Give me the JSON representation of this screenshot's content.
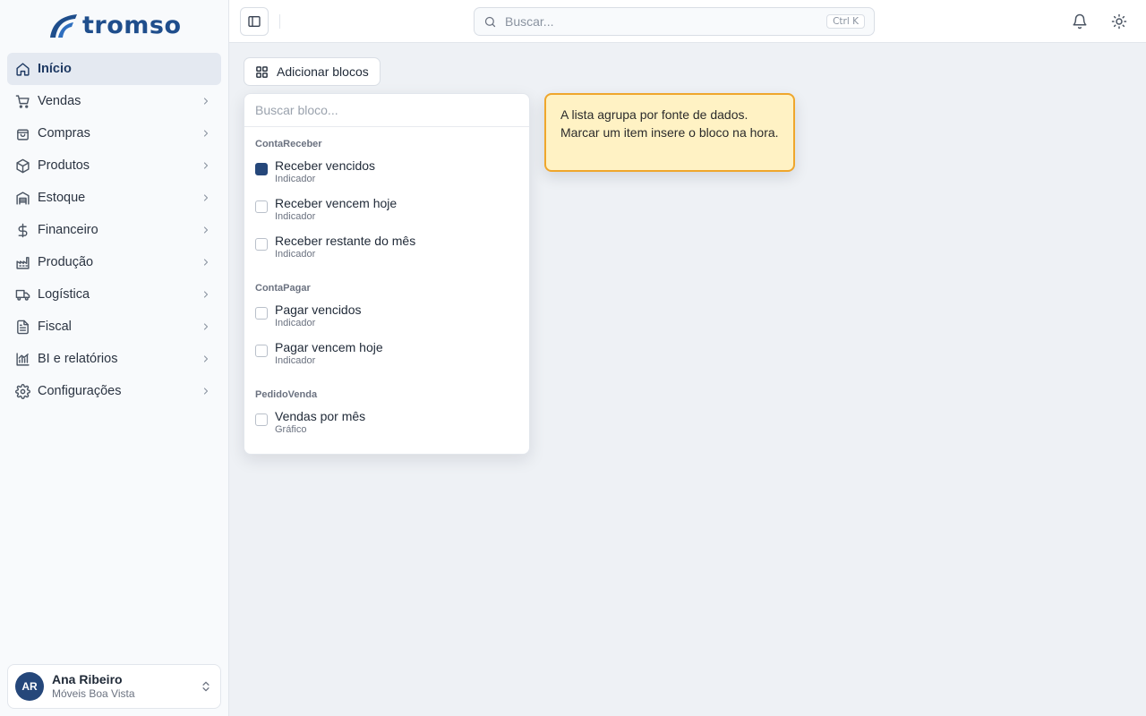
{
  "app": {
    "logo_text": "tromso"
  },
  "sidebar": {
    "items": [
      {
        "label": "Início",
        "icon": "home-icon",
        "active": true
      },
      {
        "label": "Vendas",
        "icon": "cart-icon"
      },
      {
        "label": "Compras",
        "icon": "shopping-bag-icon"
      },
      {
        "label": "Produtos",
        "icon": "package-icon"
      },
      {
        "label": "Estoque",
        "icon": "warehouse-icon"
      },
      {
        "label": "Financeiro",
        "icon": "dollar-icon"
      },
      {
        "label": "Produção",
        "icon": "factory-icon"
      },
      {
        "label": "Logística",
        "icon": "truck-icon"
      },
      {
        "label": "Fiscal",
        "icon": "file-text-icon"
      },
      {
        "label": "BI e relatórios",
        "icon": "chart-icon"
      },
      {
        "label": "Configurações",
        "icon": "gear-icon"
      }
    ],
    "user": {
      "initials": "AR",
      "name": "Ana Ribeiro",
      "company": "Móveis Boa Vista"
    }
  },
  "header": {
    "search_placeholder": "Buscar...",
    "search_shortcut": "Ctrl K"
  },
  "main": {
    "add_blocks_label": "Adicionar blocos",
    "block_picker": {
      "search_placeholder": "Buscar bloco...",
      "groups": [
        {
          "title": "ContaReceber",
          "items": [
            {
              "label": "Receber vencidos",
              "type": "Indicador",
              "checked": true
            },
            {
              "label": "Receber vencem hoje",
              "type": "Indicador",
              "checked": false
            },
            {
              "label": "Receber restante do mês",
              "type": "Indicador",
              "checked": false
            }
          ]
        },
        {
          "title": "ContaPagar",
          "items": [
            {
              "label": "Pagar vencidos",
              "type": "Indicador",
              "checked": false
            },
            {
              "label": "Pagar vencem hoje",
              "type": "Indicador",
              "checked": false
            }
          ]
        },
        {
          "title": "PedidoVenda",
          "items": [
            {
              "label": "Vendas por mês",
              "type": "Gráfico",
              "checked": false
            }
          ]
        }
      ]
    },
    "tooltip": "A lista agrupa por fonte de dados. Marcar um item insere o bloco na hora."
  },
  "colors": {
    "brand": "#1f4e8c",
    "accent": "#25477a",
    "tooltip_bg": "#fff2c4",
    "tooltip_border": "#efa62c"
  }
}
